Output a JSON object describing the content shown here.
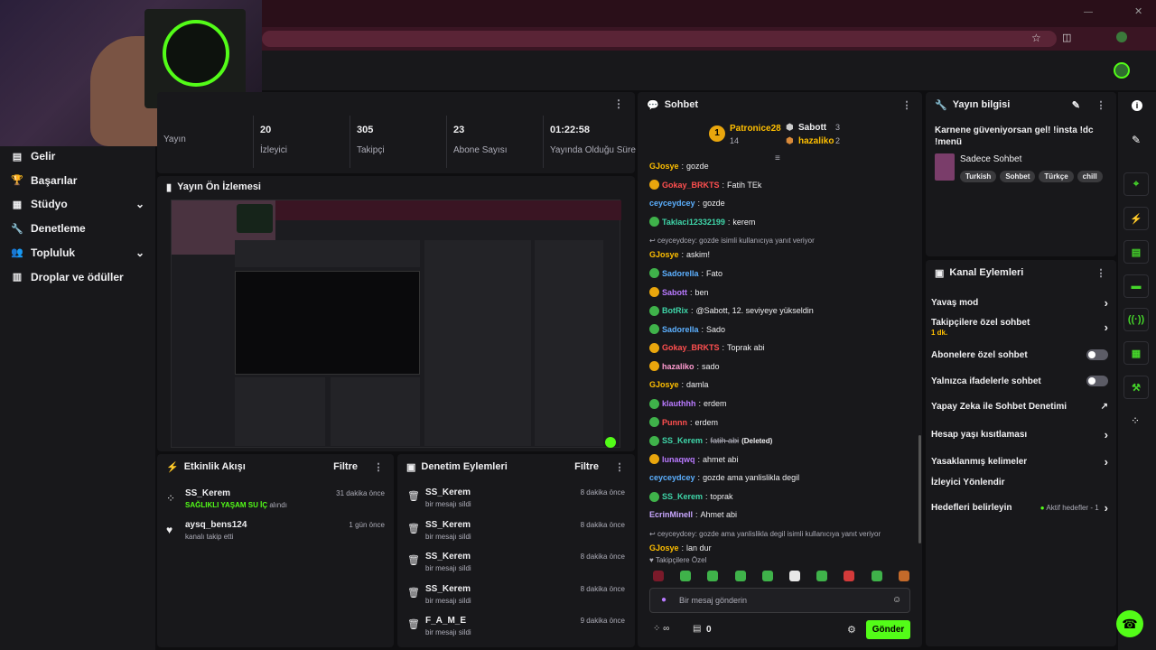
{
  "browser": {
    "accent": "#3a1523"
  },
  "nav": {
    "items": [
      {
        "label": "Gelir",
        "icon": "money-icon"
      },
      {
        "label": "Başarılar",
        "icon": "trophy-icon"
      },
      {
        "label": "Stüdyo",
        "icon": "studio-icon"
      },
      {
        "label": "Denetleme",
        "icon": "wrench-icon"
      },
      {
        "label": "Topluluk",
        "icon": "people-icon"
      },
      {
        "label": "Droplar ve ödüller",
        "icon": "drops-icon"
      }
    ]
  },
  "stats": [
    {
      "value": "",
      "label": "Yayın"
    },
    {
      "value": "20",
      "label": "İzleyici"
    },
    {
      "value": "305",
      "label": "Takipçi"
    },
    {
      "value": "23",
      "label": "Abone Sayısı"
    },
    {
      "value": "01:22:58",
      "label": "Yayında Olduğu Süre"
    }
  ],
  "preview": {
    "title": "Yayın Ön İzlemesi"
  },
  "activity": {
    "title": "Etkinlik Akışı",
    "filter": "Filtre",
    "items": [
      {
        "user": "SS_Kerem",
        "detail": "SAĞLIKLI YAŞAM SU İÇ",
        "suffix": "alındı",
        "time": "31 dakika önce"
      },
      {
        "user": "aysq_bens124",
        "detail": "",
        "suffix": "kanalı takip etti",
        "time": "1 gün önce"
      }
    ]
  },
  "moderation": {
    "title": "Denetim Eylemleri",
    "filter": "Filtre",
    "items": [
      {
        "user": "SS_Kerem",
        "action": "bir mesajı sildi",
        "time": "8 dakika önce"
      },
      {
        "user": "SS_Kerem",
        "action": "bir mesajı sildi",
        "time": "8 dakika önce"
      },
      {
        "user": "SS_Kerem",
        "action": "bir mesajı sildi",
        "time": "8 dakika önce"
      },
      {
        "user": "SS_Kerem",
        "action": "bir mesajı sildi",
        "time": "8 dakika önce"
      },
      {
        "user": "F_A_M_E",
        "action": "bir mesajı sildi",
        "time": "9 dakika önce"
      }
    ]
  },
  "chat": {
    "title": "Sohbet",
    "leaders": [
      {
        "rank": "1",
        "name": "Patronice28",
        "count": "14"
      },
      {
        "name": "Sabott",
        "count": "3"
      },
      {
        "name": "hazaliko",
        "count": "2"
      }
    ],
    "messages": [
      {
        "user": "GJosye",
        "color": "#ffbf00",
        "text": "gozde",
        "badge": ""
      },
      {
        "user": "Gokay_BRKTS",
        "color": "#ff4f4f",
        "text": "Fatih TEk",
        "badge": "#e9a60d"
      },
      {
        "user": "ceyceydcey",
        "color": "#5cb0ff",
        "text": "gozde",
        "badge": ""
      },
      {
        "user": "Taklaci12332199",
        "color": "#3fd6a9",
        "text": "kerem",
        "badge": "#3fb24a"
      },
      {
        "reply": "ceyceydcey: gozde isimli kullanıcıya yanıt veriyor"
      },
      {
        "user": "GJosye",
        "color": "#ffbf00",
        "text": "askim!",
        "badge": ""
      },
      {
        "user": "Sadorella",
        "color": "#5cb0ff",
        "text": "Fato",
        "badge": "#3fb24a"
      },
      {
        "user": "Sabott",
        "color": "#b97aff",
        "text": "ben",
        "badge": "#e9a60d"
      },
      {
        "user": "BotRix",
        "color": "#3fd6a9",
        "text": "@Sabott, 12. seviyeye yükseldin",
        "badge": "#3fb24a"
      },
      {
        "user": "Sadorella",
        "color": "#5cb0ff",
        "text": "Sado",
        "badge": "#3fb24a"
      },
      {
        "user": "Gokay_BRKTS",
        "color": "#ff4f4f",
        "text": "Toprak abi",
        "badge": "#e9a60d"
      },
      {
        "user": "hazaliko",
        "color": "#ff9bd0",
        "text": "sado",
        "badge": "#e9a60d"
      },
      {
        "user": "GJosye",
        "color": "#ffbf00",
        "text": "damla",
        "badge": ""
      },
      {
        "user": "klauthhh",
        "color": "#b97aff",
        "text": "erdem",
        "badge": "#3fb24a"
      },
      {
        "user": "Punnn",
        "color": "#ff4f4f",
        "text": "erdem",
        "badge": "#3fb24a"
      },
      {
        "user": "SS_Kerem",
        "color": "#3fd6a9",
        "text": "fatih abi",
        "badge": "#3fb24a",
        "deleted": "(Deleted)"
      },
      {
        "user": "lunaqwq",
        "color": "#b97aff",
        "text": "ahmet abi",
        "badge": "#e9a60d"
      },
      {
        "user": "ceyceydcey",
        "color": "#5cb0ff",
        "text": "gozde ama yanlislikla degil",
        "badge": ""
      },
      {
        "user": "SS_Kerem",
        "color": "#3fd6a9",
        "text": "toprak",
        "badge": "#3fb24a"
      },
      {
        "user": "EcrinMinell",
        "color": "#c9a7ff",
        "text": "Ahmet abi",
        "badge": ""
      },
      {
        "reply": "ceyceydcey: gozde ama yanlislikla degil isimli kullanıcıya yanıt veriyor"
      },
      {
        "user": "GJosye",
        "color": "#ffbf00",
        "text": "lan dur",
        "badge": ""
      }
    ],
    "emote_section": "Takipçilere Özel",
    "placeholder": "Bir mesaj gönderin",
    "points": "0",
    "send": "Gönder"
  },
  "stream_info": {
    "title": "Yayın bilgisi",
    "stream_title": "Karnene güveniyorsan gel! !insta !dc !menü",
    "category": "Sadece Sohbet",
    "tags": [
      "Turkish",
      "Sohbet",
      "Türkçe",
      "chill"
    ]
  },
  "channel_actions": {
    "title": "Kanal Eylemleri",
    "items": [
      {
        "label": "Yavaş mod",
        "kind": "chevron"
      },
      {
        "label": "Takipçilere özel sohbet",
        "sub": "1 dk.",
        "kind": "chevron"
      },
      {
        "label": "Abonelere özel sohbet",
        "kind": "toggle"
      },
      {
        "label": "Yalnızca ifadelerle sohbet",
        "kind": "toggle"
      },
      {
        "label": "Yapay Zeka ile Sohbet Denetimi",
        "kind": "external"
      },
      {
        "label": "Hesap yaşı kısıtlaması",
        "kind": "chevron"
      },
      {
        "label": "Yasaklanmış kelimeler",
        "kind": "chevron"
      },
      {
        "label": "İzleyici Yönlendir",
        "kind": "none"
      },
      {
        "label": "Hedefleri belirleyin",
        "kind": "chevron",
        "extra": "Aktif hedefler - 1"
      }
    ]
  },
  "colors": {
    "accent": "#53fc18",
    "panel": "#18181b",
    "bg": "#0e0e10"
  }
}
